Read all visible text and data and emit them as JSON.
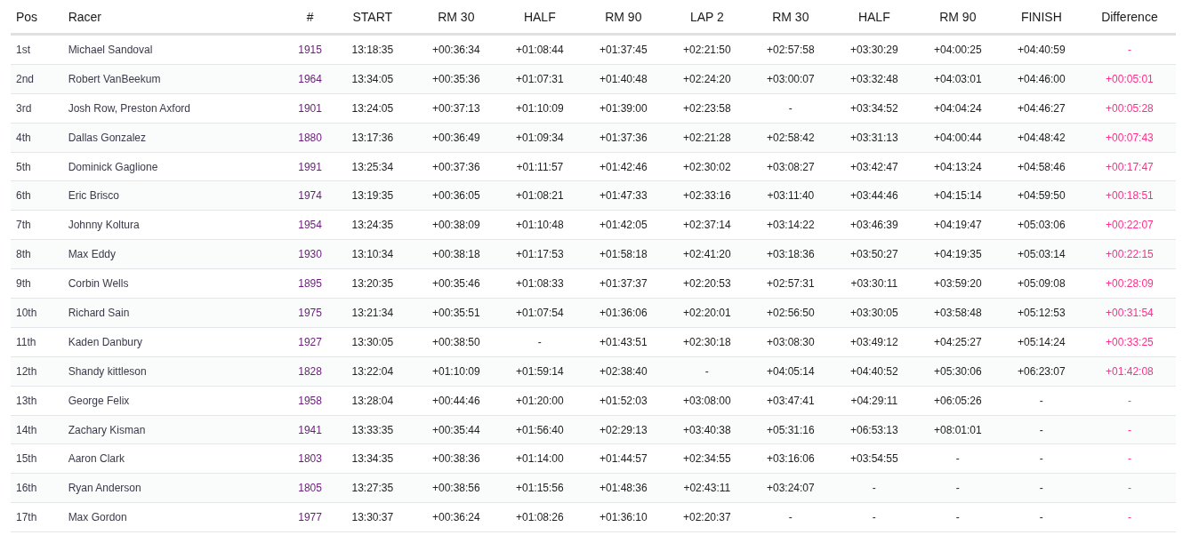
{
  "table": {
    "columns": [
      {
        "label": "Pos",
        "kind": "pos"
      },
      {
        "label": "Racer",
        "kind": "name"
      },
      {
        "label": "#",
        "kind": "bib"
      },
      {
        "label": "START",
        "kind": "time"
      },
      {
        "label": "RM 30",
        "kind": "time"
      },
      {
        "label": "HALF",
        "kind": "time"
      },
      {
        "label": "RM 90",
        "kind": "time"
      },
      {
        "label": "LAP 2",
        "kind": "time"
      },
      {
        "label": "RM 30",
        "kind": "time"
      },
      {
        "label": "HALF",
        "kind": "time"
      },
      {
        "label": "RM 90",
        "kind": "time"
      },
      {
        "label": "FINISH",
        "kind": "time"
      },
      {
        "label": "Difference",
        "kind": "diff"
      }
    ],
    "rows": [
      [
        "1st",
        "Michael Sandoval",
        "1915",
        "13:18:35",
        "+00:36:34",
        "+01:08:44",
        "+01:37:45",
        "+02:21:50",
        "+02:57:58",
        "+03:30:29",
        "+04:00:25",
        "+04:40:59",
        "-"
      ],
      [
        "2nd",
        "Robert VanBeekum",
        "1964",
        "13:34:05",
        "+00:35:36",
        "+01:07:31",
        "+01:40:48",
        "+02:24:20",
        "+03:00:07",
        "+03:32:48",
        "+04:03:01",
        "+04:46:00",
        "+00:05:01"
      ],
      [
        "3rd",
        "Josh Row, Preston Axford",
        "1901",
        "13:24:05",
        "+00:37:13",
        "+01:10:09",
        "+01:39:00",
        "+02:23:58",
        "-",
        "+03:34:52",
        "+04:04:24",
        "+04:46:27",
        "+00:05:28"
      ],
      [
        "4th",
        "Dallas Gonzalez",
        "1880",
        "13:17:36",
        "+00:36:49",
        "+01:09:34",
        "+01:37:36",
        "+02:21:28",
        "+02:58:42",
        "+03:31:13",
        "+04:00:44",
        "+04:48:42",
        "+00:07:43"
      ],
      [
        "5th",
        "Dominick Gaglione",
        "1991",
        "13:25:34",
        "+00:37:36",
        "+01:11:57",
        "+01:42:46",
        "+02:30:02",
        "+03:08:27",
        "+03:42:47",
        "+04:13:24",
        "+04:58:46",
        "+00:17:47"
      ],
      [
        "6th",
        "Eric Brisco",
        "1974",
        "13:19:35",
        "+00:36:05",
        "+01:08:21",
        "+01:47:33",
        "+02:33:16",
        "+03:11:40",
        "+03:44:46",
        "+04:15:14",
        "+04:59:50",
        "+00:18:51"
      ],
      [
        "7th",
        "Johnny Koltura",
        "1954",
        "13:24:35",
        "+00:38:09",
        "+01:10:48",
        "+01:42:05",
        "+02:37:14",
        "+03:14:22",
        "+03:46:39",
        "+04:19:47",
        "+05:03:06",
        "+00:22:07"
      ],
      [
        "8th",
        "Max Eddy",
        "1930",
        "13:10:34",
        "+00:38:18",
        "+01:17:53",
        "+01:58:18",
        "+02:41:20",
        "+03:18:36",
        "+03:50:27",
        "+04:19:35",
        "+05:03:14",
        "+00:22:15"
      ],
      [
        "9th",
        "Corbin Wells",
        "1895",
        "13:20:35",
        "+00:35:46",
        "+01:08:33",
        "+01:37:37",
        "+02:20:53",
        "+02:57:31",
        "+03:30:11",
        "+03:59:20",
        "+05:09:08",
        "+00:28:09"
      ],
      [
        "10th",
        "Richard Sain",
        "1975",
        "13:21:34",
        "+00:35:51",
        "+01:07:54",
        "+01:36:06",
        "+02:20:01",
        "+02:56:50",
        "+03:30:05",
        "+03:58:48",
        "+05:12:53",
        "+00:31:54"
      ],
      [
        "11th",
        "Kaden Danbury",
        "1927",
        "13:30:05",
        "+00:38:50",
        "-",
        "+01:43:51",
        "+02:30:18",
        "+03:08:30",
        "+03:49:12",
        "+04:25:27",
        "+05:14:24",
        "+00:33:25"
      ],
      [
        "12th",
        "Shandy kittleson",
        "1828",
        "13:22:04",
        "+01:10:09",
        "+01:59:14",
        "+02:38:40",
        "-",
        "+04:05:14",
        "+04:40:52",
        "+05:30:06",
        "+06:23:07",
        "+01:42:08"
      ],
      [
        "13th",
        "George Felix",
        "1958",
        "13:28:04",
        "+00:44:46",
        "+01:20:00",
        "+01:52:03",
        "+03:08:00",
        "+03:47:41",
        "+04:29:11",
        "+06:05:26",
        "-",
        "-"
      ],
      [
        "14th",
        "Zachary Kisman",
        "1941",
        "13:33:35",
        "+00:35:44",
        "+01:56:40",
        "+02:29:13",
        "+03:40:38",
        "+05:31:16",
        "+06:53:13",
        "+08:01:01",
        "-",
        "-"
      ],
      [
        "15th",
        "Aaron Clark",
        "1803",
        "13:34:35",
        "+00:38:36",
        "+01:14:00",
        "+01:44:57",
        "+02:34:55",
        "+03:16:06",
        "+03:54:55",
        "-",
        "-",
        "-"
      ],
      [
        "16th",
        "Ryan Anderson",
        "1805",
        "13:27:35",
        "+00:38:56",
        "+01:15:56",
        "+01:48:36",
        "+02:43:11",
        "+03:24:07",
        "-",
        "-",
        "-",
        "-"
      ],
      [
        "17th",
        "Max Gordon",
        "1977",
        "13:30:37",
        "+00:36:24",
        "+01:08:26",
        "+01:36:10",
        "+02:20:37",
        "-",
        "-",
        "-",
        "-",
        "-"
      ]
    ]
  }
}
